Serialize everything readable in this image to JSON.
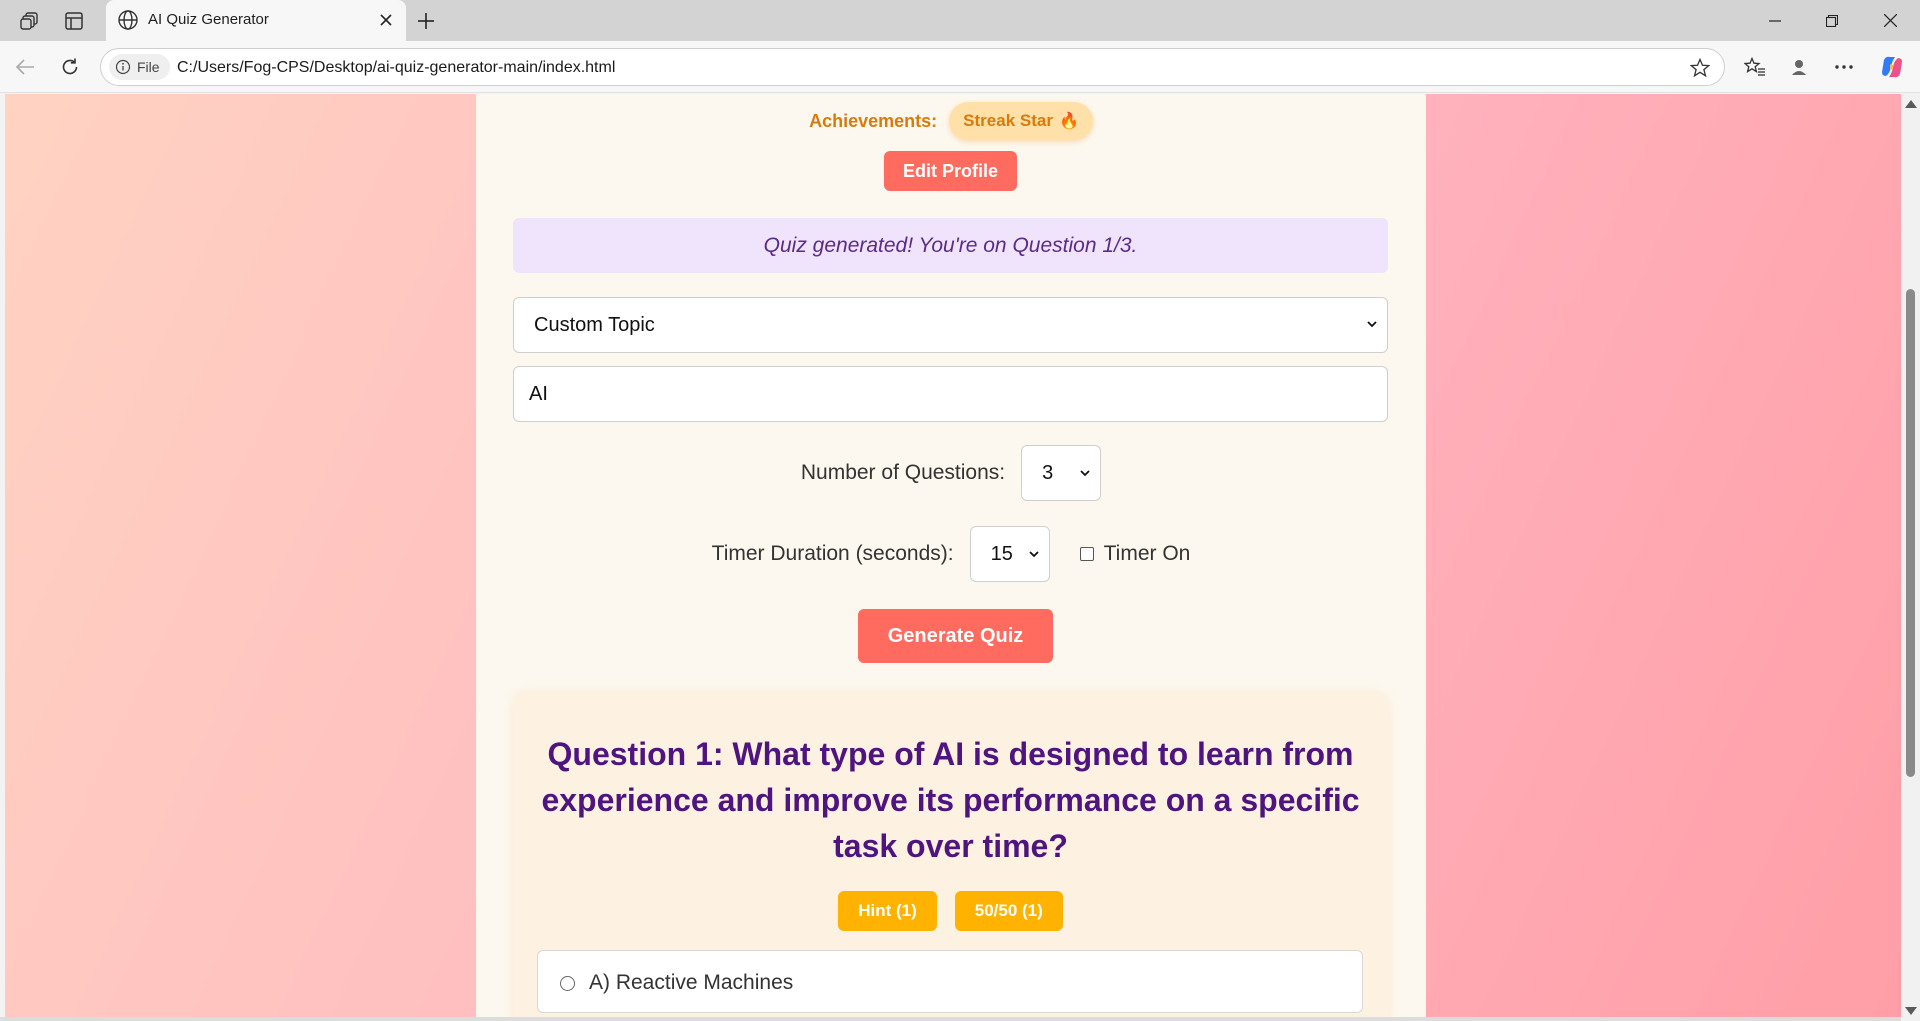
{
  "browser": {
    "tab_title": "AI Quiz Generator",
    "address_badge": "File",
    "url": "C:/Users/Fog-CPS/Desktop/ai-quiz-generator-main/index.html"
  },
  "profile": {
    "achievements_label": "Achievements:",
    "badge_label": "Streak Star",
    "badge_icon": "🔥",
    "edit_button": "Edit Profile"
  },
  "status_message": "Quiz generated! You're on Question 1/3.",
  "form": {
    "topic_selected": "Custom Topic",
    "custom_topic_value": "AI",
    "num_questions_label": "Number of Questions:",
    "num_questions_value": "3",
    "timer_label": "Timer Duration (seconds):",
    "timer_value": "15",
    "timer_toggle_label": "Timer On",
    "timer_checked": false,
    "generate_button": "Generate Quiz"
  },
  "quiz": {
    "question": "Question 1: What type of AI is designed to learn from experience and improve its performance on a specific task over time?",
    "hint_button": "Hint (1)",
    "fifty_button": "50/50 (1)",
    "options": [
      "A) Reactive Machines"
    ]
  },
  "colors": {
    "primary_button": "#ff6b5e",
    "hint_button": "#ffb300",
    "question_text": "#4e1480",
    "status_bg": "#efe4fb"
  }
}
